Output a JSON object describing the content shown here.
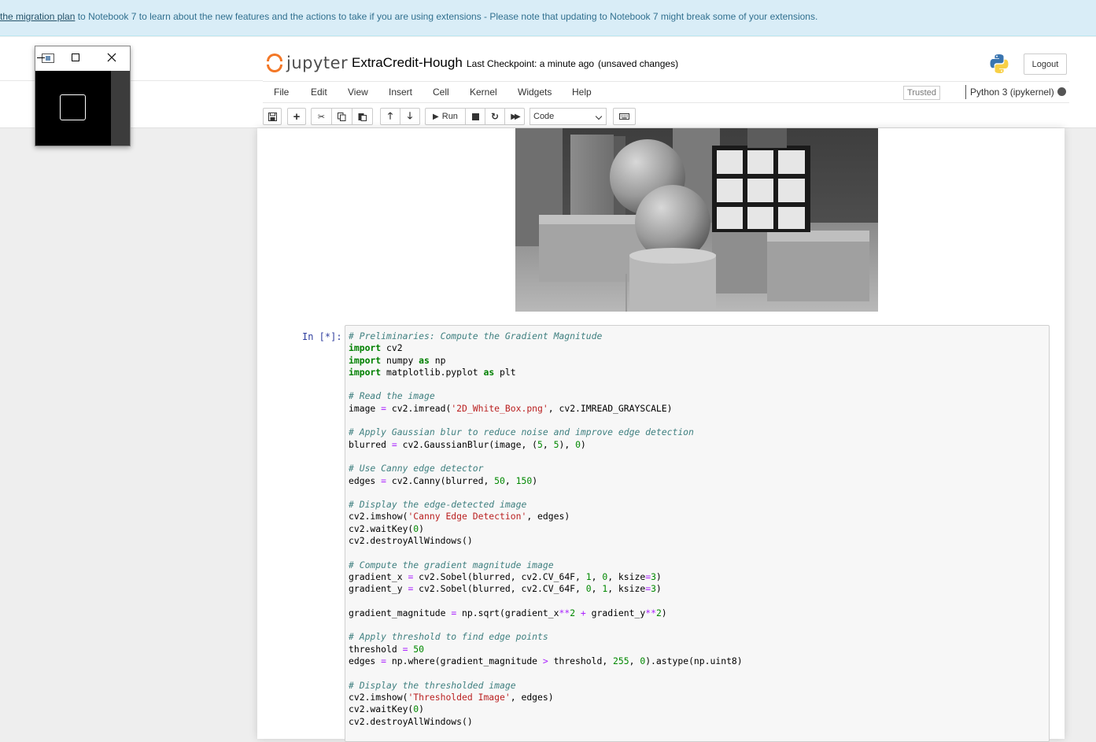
{
  "banner": {
    "link_text": "the migration plan",
    "text": " to Notebook 7 to learn about the new features and the actions to take if you are using extensions - Please note that updating to Notebook 7 might break some of your extensions."
  },
  "header": {
    "logo_text": "jupyter",
    "notebook_name": "ExtraCredit-Hough",
    "checkpoint": "Last Checkpoint: a minute ago",
    "unsaved": "(unsaved changes)",
    "logout": "Logout"
  },
  "menu": {
    "items": [
      "File",
      "Edit",
      "View",
      "Insert",
      "Cell",
      "Kernel",
      "Widgets",
      "Help"
    ],
    "trusted": "Trusted",
    "kernel": "Python 3 (ipykernel)"
  },
  "toolbar": {
    "run_label": "Run",
    "cell_type": "Code"
  },
  "cell": {
    "prompt": "In [*]:"
  },
  "colors": {
    "jupyter_orange": "#f37726",
    "banner_bg": "#d9edf7",
    "prompt_blue": "#303f9f",
    "comment": "#408080",
    "keyword": "#008000",
    "string": "#ba2121"
  },
  "icons": [
    "save-icon",
    "plus-icon",
    "scissors-icon",
    "copy-icon",
    "paste-icon",
    "arrow-up-icon",
    "arrow-down-icon",
    "play-icon",
    "stop-icon",
    "restart-icon",
    "fast-forward-icon",
    "keyboard-icon",
    "python-logo-icon",
    "minimize-icon",
    "maximize-icon",
    "close-icon"
  ]
}
